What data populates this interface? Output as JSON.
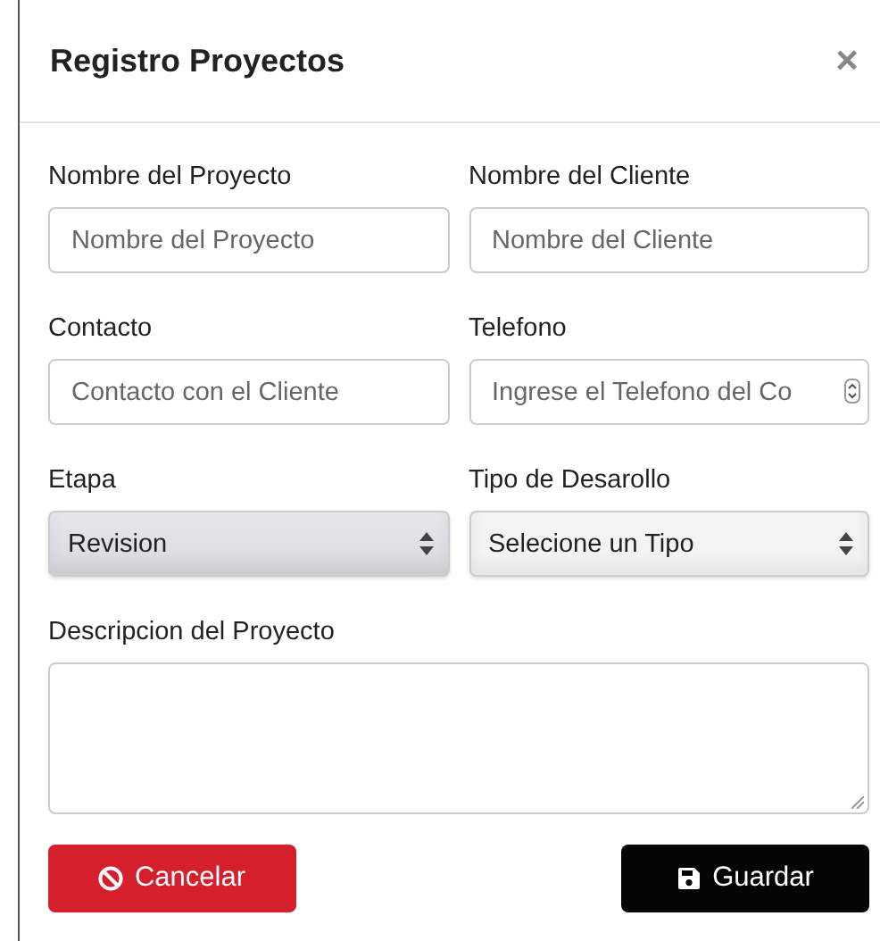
{
  "modal": {
    "title": "Registro Proyectos",
    "close": "×"
  },
  "fields": [
    {
      "kind": "text",
      "label": "Nombre del Proyecto",
      "placeholder": "Nombre del Proyecto"
    },
    {
      "kind": "text",
      "label": "Nombre del Cliente",
      "placeholder": "Nombre del Cliente"
    },
    {
      "kind": "text",
      "label": "Contacto",
      "placeholder": "Contacto con el Cliente"
    },
    {
      "kind": "number",
      "label": "Telefono",
      "placeholder": "Ingrese el Telefono del Co"
    },
    {
      "kind": "select",
      "label": "Etapa",
      "value": "Revision",
      "selected": true
    },
    {
      "kind": "select",
      "label": "Tipo de Desarollo",
      "value": "Selecione un Tipo",
      "selected": false
    },
    {
      "kind": "textarea",
      "label": "Descripcion del Proyecto"
    }
  ],
  "buttons": [
    {
      "kind": "cancel",
      "label": "Cancelar"
    },
    {
      "kind": "save",
      "label": "Guardar"
    }
  ]
}
